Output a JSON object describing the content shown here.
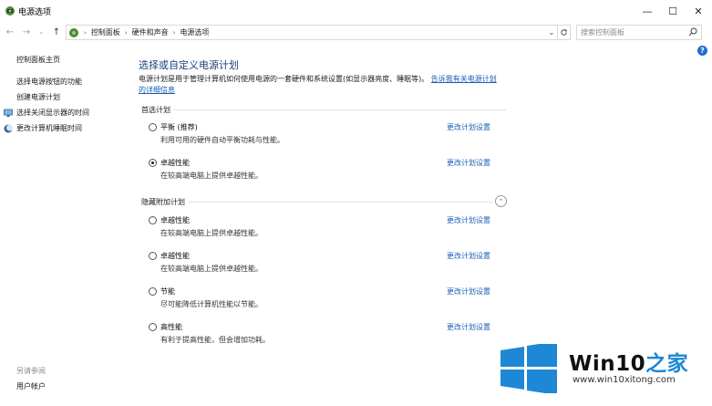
{
  "window": {
    "title": "电源选项",
    "controls": {
      "minimize": "—",
      "maximize": "☐",
      "close": "✕"
    }
  },
  "address": {
    "back": "←",
    "forward": "→",
    "dropdown": "⌄",
    "up": "↑",
    "breadcrumbs": [
      "控制面板",
      "硬件和声音",
      "电源选项"
    ],
    "separator": "›",
    "search_placeholder": "搜索控制面板"
  },
  "sidebar": {
    "home": "控制面板主页",
    "items": [
      {
        "label": "选择电源按钮的功能",
        "icon": ""
      },
      {
        "label": "创建电源计划",
        "icon": ""
      },
      {
        "label": "选择关闭显示器的时间",
        "icon": "monitor-icon"
      },
      {
        "label": "更改计算机睡眠时间",
        "icon": "moon-icon"
      }
    ],
    "see_also": "另请参阅",
    "accounts": "用户帐户"
  },
  "main": {
    "title": "选择或自定义电源计划",
    "description": "电源计划是用于管理计算机如何使用电源的一套硬件和系统设置(如显示器亮度、睡眠等)。",
    "description_link": "告诉我有关电源计划的详细信息",
    "preferred_label": "首选计划",
    "preferred": [
      {
        "name": "平衡 (推荐)",
        "desc": "利用可用的硬件自动平衡功耗与性能。",
        "link": "更改计划设置",
        "checked": false
      },
      {
        "name": "卓越性能",
        "desc": "在较高端电脑上提供卓越性能。",
        "link": "更改计划设置",
        "checked": true
      }
    ],
    "hidden_label": "隐藏附加计划",
    "collapse_icon": "⌃",
    "hidden": [
      {
        "name": "卓越性能",
        "desc": "在较高端电脑上提供卓越性能。",
        "link": "更改计划设置",
        "checked": false
      },
      {
        "name": "卓越性能",
        "desc": "在较高端电脑上提供卓越性能。",
        "link": "更改计划设置",
        "checked": false
      },
      {
        "name": "节能",
        "desc": "尽可能降低计算机性能以节能。",
        "link": "更改计划设置",
        "checked": false
      },
      {
        "name": "高性能",
        "desc": "有利于提高性能，但会增加功耗。",
        "link": "更改计划设置",
        "checked": false
      }
    ]
  },
  "help": "?",
  "watermark": {
    "brand_a": "Win10",
    "brand_b": "之家",
    "url": "www.win10xitong.com",
    "colors": {
      "logo_blue": "#1e88d6"
    }
  }
}
